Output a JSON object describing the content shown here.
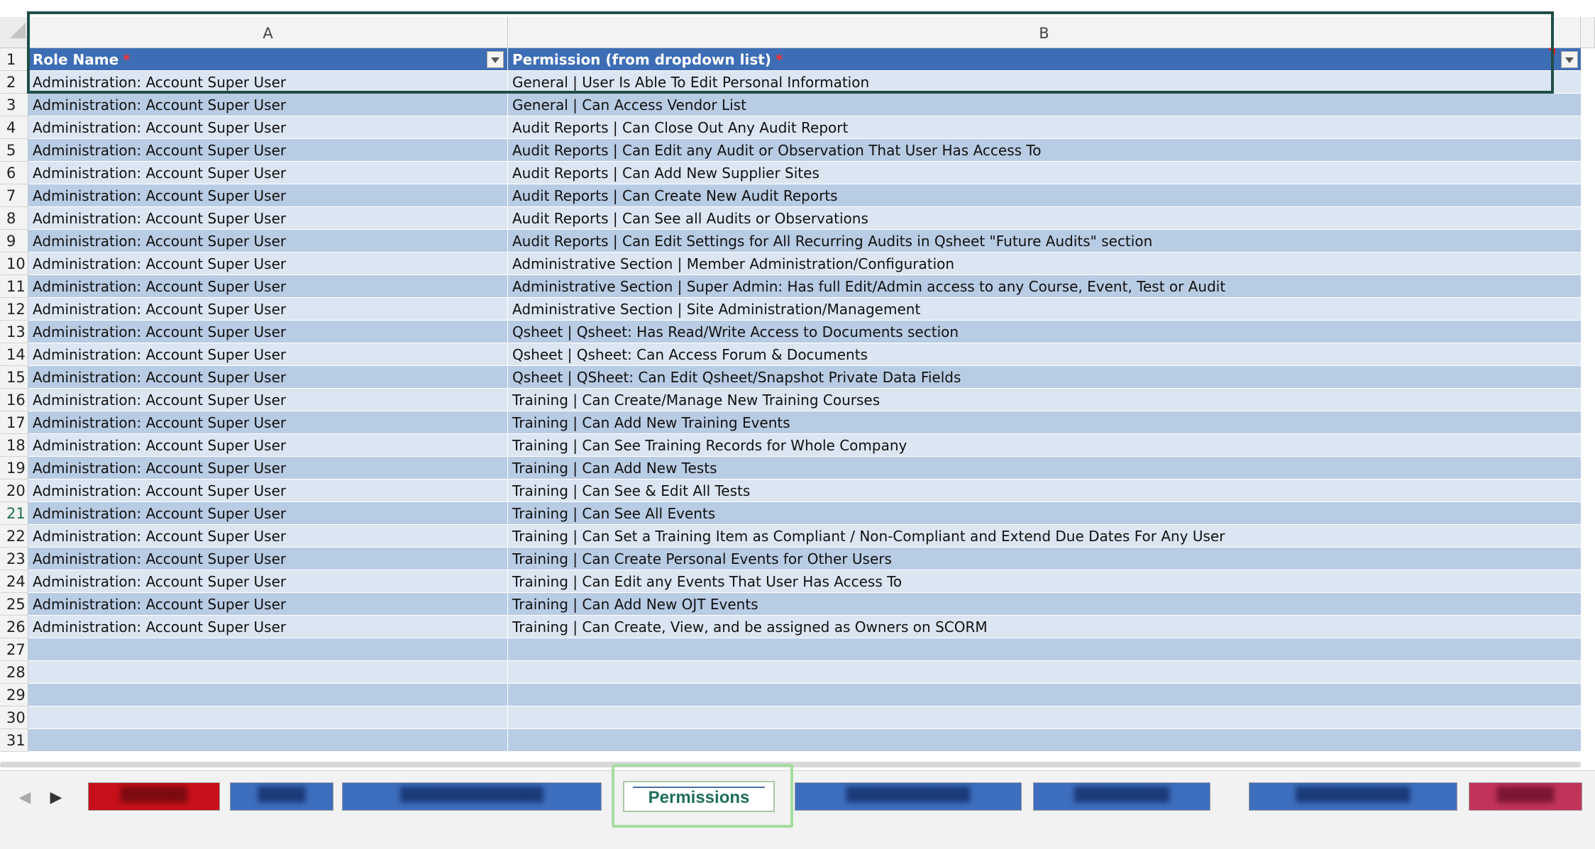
{
  "columns": {
    "a": "A",
    "b": "B"
  },
  "header_row": {
    "number": "1",
    "role_name": "Role Name",
    "permission": "Permission (from dropdown list)",
    "required_marker": "*"
  },
  "rows": [
    {
      "n": "2",
      "role": "Administration: Account Super User",
      "perm": "General | User Is Able To Edit Personal Information"
    },
    {
      "n": "3",
      "role": "Administration: Account Super User",
      "perm": "General | Can Access Vendor List"
    },
    {
      "n": "4",
      "role": "Administration: Account Super User",
      "perm": "Audit Reports | Can Close Out Any Audit Report"
    },
    {
      "n": "5",
      "role": "Administration: Account Super User",
      "perm": "Audit Reports | Can Edit any Audit or Observation That User Has Access To"
    },
    {
      "n": "6",
      "role": "Administration: Account Super User",
      "perm": "Audit Reports | Can Add New Supplier Sites"
    },
    {
      "n": "7",
      "role": "Administration: Account Super User",
      "perm": "Audit Reports | Can Create New Audit Reports"
    },
    {
      "n": "8",
      "role": "Administration: Account Super User",
      "perm": "Audit Reports | Can See all Audits or Observations"
    },
    {
      "n": "9",
      "role": "Administration: Account Super User",
      "perm": "Audit Reports | Can Edit Settings for All Recurring Audits in Qsheet \"Future Audits\" section"
    },
    {
      "n": "10",
      "role": "Administration: Account Super User",
      "perm": "Administrative Section | Member Administration/Configuration"
    },
    {
      "n": "11",
      "role": "Administration: Account Super User",
      "perm": "Administrative Section | Super Admin: Has full Edit/Admin access to any Course, Event, Test or Audit"
    },
    {
      "n": "12",
      "role": "Administration: Account Super User",
      "perm": "Administrative Section | Site Administration/Management"
    },
    {
      "n": "13",
      "role": "Administration: Account Super User",
      "perm": "Qsheet | Qsheet: Has Read/Write Access to Documents section"
    },
    {
      "n": "14",
      "role": "Administration: Account Super User",
      "perm": "Qsheet | Qsheet: Can Access Forum & Documents"
    },
    {
      "n": "15",
      "role": "Administration: Account Super User",
      "perm": "Qsheet | QSheet: Can Edit Qsheet/Snapshot Private Data Fields"
    },
    {
      "n": "16",
      "role": "Administration: Account Super User",
      "perm": "Training | Can Create/Manage New Training Courses"
    },
    {
      "n": "17",
      "role": "Administration: Account Super User",
      "perm": "Training | Can Add New Training Events"
    },
    {
      "n": "18",
      "role": "Administration: Account Super User",
      "perm": "Training | Can See Training Records for Whole Company"
    },
    {
      "n": "19",
      "role": "Administration: Account Super User",
      "perm": "Training | Can Add New Tests"
    },
    {
      "n": "20",
      "role": "Administration: Account Super User",
      "perm": "Training | Can See & Edit All Tests"
    },
    {
      "n": "21",
      "role": "Administration: Account Super User",
      "perm": "Training | Can See All Events"
    },
    {
      "n": "22",
      "role": "Administration: Account Super User",
      "perm": "Training | Can Set a Training Item as Compliant / Non-Compliant and Extend Due Dates For Any User"
    },
    {
      "n": "23",
      "role": "Administration: Account Super User",
      "perm": "Training | Can Create Personal Events for Other Users"
    },
    {
      "n": "24",
      "role": "Administration: Account Super User",
      "perm": "Training | Can Edit any Events That User Has Access To"
    },
    {
      "n": "25",
      "role": "Administration: Account Super User",
      "perm": "Training | Can Add New OJT Events"
    },
    {
      "n": "26",
      "role": "Administration: Account Super User",
      "perm": "Training | Can Create, View, and be assigned as Owners on SCORM"
    },
    {
      "n": "27",
      "role": "",
      "perm": ""
    },
    {
      "n": "28",
      "role": "",
      "perm": ""
    },
    {
      "n": "29",
      "role": "",
      "perm": ""
    },
    {
      "n": "30",
      "role": "",
      "perm": ""
    },
    {
      "n": "31",
      "role": "",
      "perm": ""
    }
  ],
  "active_row": "21",
  "sheet_tabs": {
    "prev_icon": "◀",
    "next_icon": "▶",
    "active_label": "Permissions"
  },
  "colors": {
    "header_fill": "#3d6db5",
    "band_light": "#dce6f2",
    "band_dark": "#b8cce4",
    "active_tab_text": "#1e6e5a",
    "selection_border": "#1f4e47",
    "tab_highlight": "#a6dca0"
  }
}
